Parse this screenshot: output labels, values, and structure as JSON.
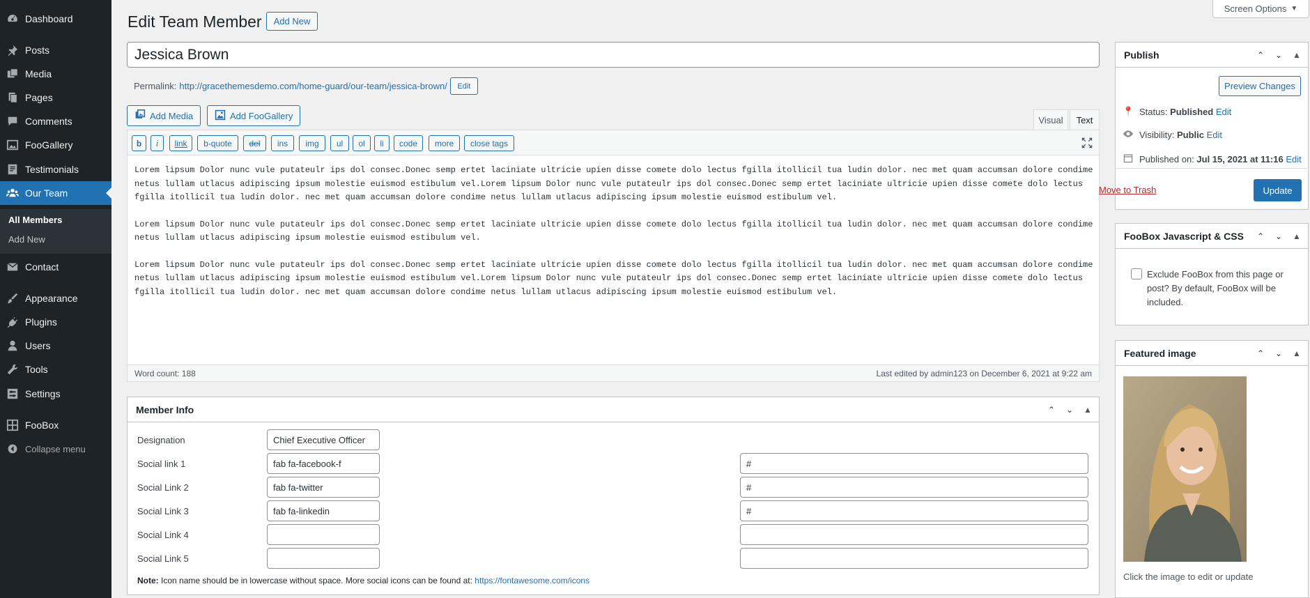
{
  "sidebar": {
    "items": [
      {
        "label": "Dashboard",
        "icon": "dashboard-icon"
      },
      {
        "label": "Posts",
        "icon": "pin-icon"
      },
      {
        "label": "Media",
        "icon": "media-icon"
      },
      {
        "label": "Pages",
        "icon": "pages-icon"
      },
      {
        "label": "Comments",
        "icon": "comments-icon"
      },
      {
        "label": "FooGallery",
        "icon": "gallery-icon"
      },
      {
        "label": "Testimonials",
        "icon": "testimonials-icon"
      },
      {
        "label": "Our Team",
        "icon": "team-icon"
      },
      {
        "label": "Contact",
        "icon": "mail-icon"
      },
      {
        "label": "Appearance",
        "icon": "brush-icon"
      },
      {
        "label": "Plugins",
        "icon": "plug-icon"
      },
      {
        "label": "Users",
        "icon": "user-icon"
      },
      {
        "label": "Tools",
        "icon": "wrench-icon"
      },
      {
        "label": "Settings",
        "icon": "settings-icon"
      },
      {
        "label": "FooBox",
        "icon": "grid-icon"
      },
      {
        "label": "Collapse menu",
        "icon": "collapse-icon"
      }
    ],
    "submenu": [
      "All Members",
      "Add New"
    ]
  },
  "header": {
    "title": "Edit Team Member",
    "add_new": "Add New",
    "screen_options": "Screen Options"
  },
  "post": {
    "title_value": "Jessica Brown",
    "permalink_label": "Permalink:",
    "permalink_base": "http://gracethemesdemo.com/home-guard/our-team/",
    "permalink_slug": "jessica-brown",
    "permalink_edit": "Edit"
  },
  "editor": {
    "add_media": "Add Media",
    "add_foogallery": "Add FooGallery",
    "tab_visual": "Visual",
    "tab_text": "Text",
    "quicktags": [
      "b",
      "i",
      "link",
      "b-quote",
      "del",
      "ins",
      "img",
      "ul",
      "ol",
      "li",
      "code",
      "more",
      "close tags"
    ],
    "paragraphs": [
      "Lorem lipsum Dolor nunc vule putateulr ips dol consec.Donec semp ertet laciniate ultricie upien disse comete dolo lectus fgilla itollicil tua ludin dolor. nec met quam accumsan dolore condime netus lullam utlacus adipiscing ipsum molestie euismod estibulum vel.Lorem lipsum Dolor nunc vule putateulr ips dol consec.Donec semp ertet laciniate ultricie upien disse comete dolo lectus fgilla itollicil tua ludin dolor. nec met quam accumsan dolore condime netus lullam utlacus adipiscing ipsum molestie euismod estibulum vel.",
      "Lorem lipsum Dolor nunc vule putateulr ips dol consec.Donec semp ertet laciniate ultricie upien disse comete dolo lectus fgilla itollicil tua ludin dolor. nec met quam accumsan dolore condime netus lullam utlacus adipiscing ipsum molestie euismod estibulum vel.",
      "Lorem lipsum Dolor nunc vule putateulr ips dol consec.Donec semp ertet laciniate ultricie upien disse comete dolo lectus fgilla itollicil tua ludin dolor. nec met quam accumsan dolore condime netus lullam utlacus adipiscing ipsum molestie euismod estibulum vel.Lorem lipsum Dolor nunc vule putateulr ips dol consec.Donec semp ertet laciniate ultricie upien disse comete dolo lectus fgilla itollicil tua ludin dolor. nec met quam accumsan dolore condime netus lullam utlacus adipiscing ipsum molestie euismod estibulum vel."
    ],
    "word_count": "Word count: 188",
    "last_edited": "Last edited by admin123 on December 6, 2021 at 9:22 am"
  },
  "member_info": {
    "title": "Member Info",
    "rows": [
      {
        "label": "Designation",
        "icon_value": "Chief Executive Officer",
        "url_value": null
      },
      {
        "label": "Social link 1",
        "icon_value": "fab fa-facebook-f",
        "url_value": "#"
      },
      {
        "label": "Social Link 2",
        "icon_value": "fab fa-twitter",
        "url_value": "#"
      },
      {
        "label": "Social Link 3",
        "icon_value": "fab fa-linkedin",
        "url_value": "#"
      },
      {
        "label": "Social Link 4",
        "icon_value": "",
        "url_value": ""
      },
      {
        "label": "Social Link 5",
        "icon_value": "",
        "url_value": ""
      }
    ],
    "note_label": "Note:",
    "note_text": "Icon name should be in lowercase without space. More social icons can be found at:",
    "note_link": "https://fontawesome.com/icons"
  },
  "publish": {
    "title": "Publish",
    "preview": "Preview Changes",
    "status_label": "Status:",
    "status_value": "Published",
    "visibility_label": "Visibility:",
    "visibility_value": "Public",
    "published_label": "Published on:",
    "published_value": "Jul 15, 2021 at 11:16",
    "edit": "Edit",
    "trash": "Move to Trash",
    "update": "Update"
  },
  "foobox": {
    "title": "FooBox Javascript & CSS",
    "checkbox_label": "Exclude FooBox from this page or post? By default, FooBox will be included."
  },
  "featured": {
    "title": "Featured image",
    "caption": "Click the image to edit or update"
  },
  "colors": {
    "sidebar_bg": "#1d2327",
    "accent": "#2271b1",
    "danger": "#b32d2e"
  }
}
